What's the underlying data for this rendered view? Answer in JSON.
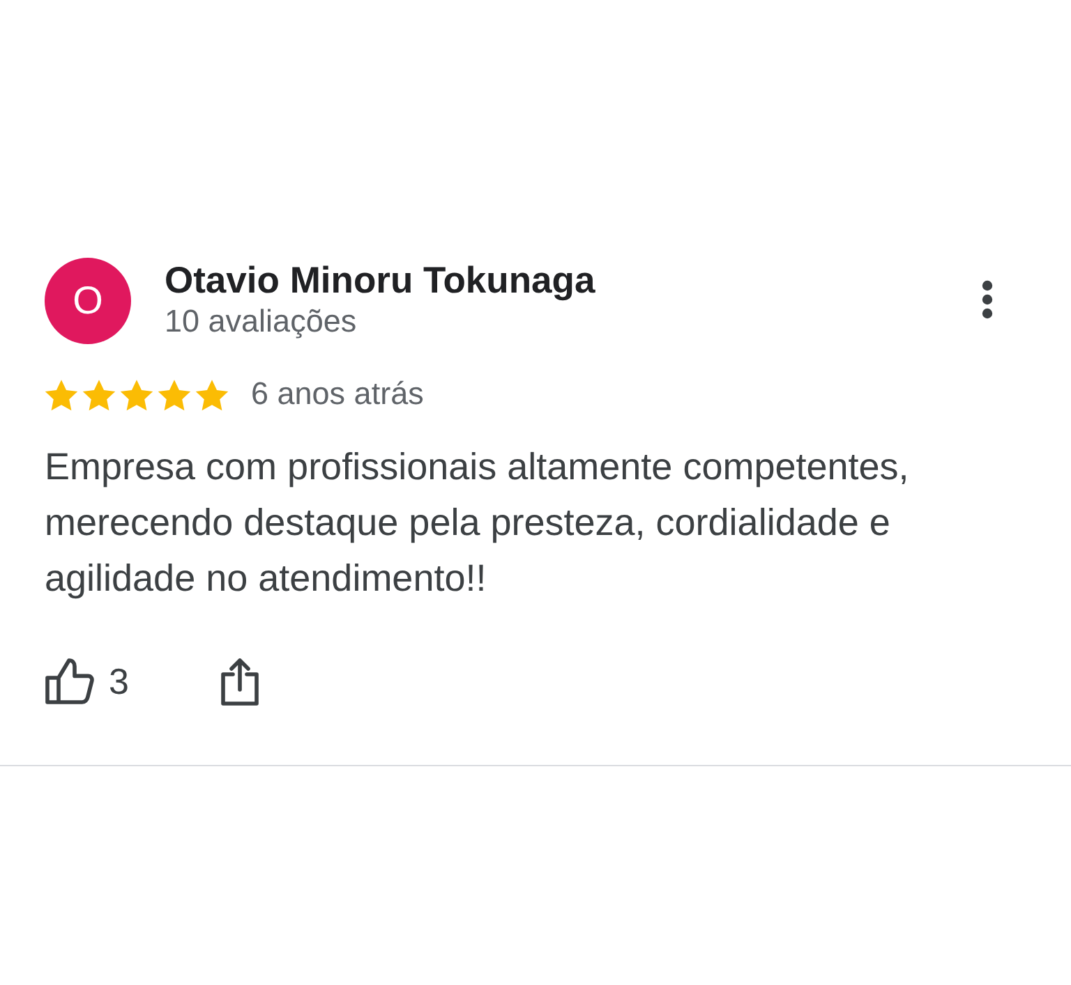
{
  "review": {
    "author": {
      "initial": "O",
      "name": "Otavio Minoru Tokunaga",
      "review_count": "10 avaliações"
    },
    "stars": 5,
    "time": "6 anos atrás",
    "text": "Empresa com profissionais altamente competentes, merecendo destaque pela presteza, cordialidade e agilidade no atendimento!!",
    "likes": "3"
  }
}
